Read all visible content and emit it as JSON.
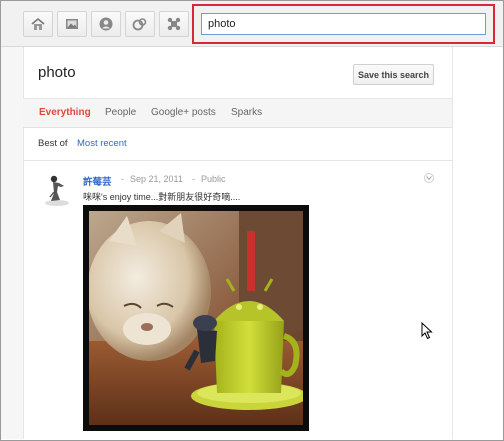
{
  "toolbar": {
    "icons": [
      "home-icon",
      "photos-icon",
      "profile-icon",
      "circles-icon",
      "games-icon"
    ]
  },
  "search": {
    "value": "photo"
  },
  "header": {
    "title": "photo",
    "save_label": "Save this search"
  },
  "tabs": [
    {
      "label": "Everything",
      "active": true
    },
    {
      "label": "People",
      "active": false
    },
    {
      "label": "Google+ posts",
      "active": false
    },
    {
      "label": "Sparks",
      "active": false
    }
  ],
  "filter": {
    "label": "Best of",
    "link": "Most recent"
  },
  "post": {
    "author": "許莓芸",
    "separator1": "-",
    "date": "Sep 21, 2011",
    "separator2": "-",
    "visibility": "Public",
    "text": "咪咪's enjoy time...對新朋友很好奇嘀....",
    "icons": [
      "avatar",
      "chevron-down-icon",
      "photo"
    ]
  },
  "colors": {
    "accent_red": "#dd4b39",
    "link_blue": "#3366cc",
    "highlight_box": "#d8283a"
  }
}
